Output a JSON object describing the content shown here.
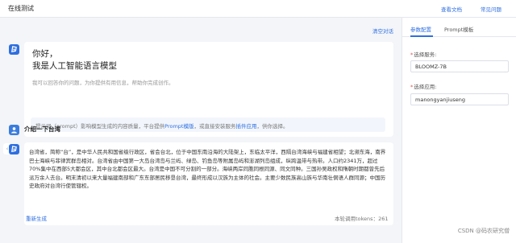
{
  "topbar": {
    "title": "在线测试",
    "docs_link": "查看文档",
    "faq_link": "常见问题"
  },
  "chat": {
    "clear_label": "清空对话",
    "welcome": {
      "greet_line1": "你好，",
      "greet_line2": "我是人工智能语言模型",
      "subtitle": "我可以回答你的问题，为你提供有用信息，帮助你完成创作。",
      "tip_prefix": "提示词（prompt）影响模型生成的内容质量，平台提供",
      "tip_link1": "Prompt模版",
      "tip_middle": "，或直接安装服务",
      "tip_link2": "插件应用",
      "tip_suffix": "，供你选择。"
    },
    "user_message": "介绍一下台湾",
    "reply_text": "台湾省，简称“台”，是中华人民共和国省级行政区，省会台北，位于中国东南沿海的大陆架上，东临太平洋，西隔台湾海峡与福建省相望；北濒东海，南界巴士海峡与菲律宾群岛相对。台湾省由中国第一大岛台湾岛与兰屿、绿岛、钓鱼岛等附属岛屿和澎湖列岛组成，纵跨温带与热带。人口约2341万，超过70%集中在西部5大都会区，其中台北都会区最大。台湾是中国不可分割的一部分。海峡两岸同胞同根同源、同文同种。三国孙吴政权和隋朝时期都曾先后派万余人去台。明末清初以来大量福建南部和广东东部居民移垦台湾，最终形成以汉族为主体的社会。主要少数民族高山族与华南壮侗语人群同源；中国历史政府对台湾行使管辖权。",
    "regenerate_label": "重新生成",
    "tokens_label": "本轮调用tokens：261",
    "scroll_glyph": "‹"
  },
  "panel": {
    "tabs": [
      {
        "label": "参数配置",
        "active": true
      },
      {
        "label": "Prompt模板",
        "active": false
      }
    ],
    "service_label": "选择服务:",
    "service_value": "BLOOMZ-7B",
    "app_label": "选择应用:",
    "app_value": "manongyanjiuseng",
    "required_mark": "*"
  },
  "watermark": "CSDN @码农研究僧",
  "colors": {
    "accent": "#2f6fe0",
    "background": "#eef1f6",
    "card": "#ffffff"
  },
  "icons": {
    "bot_avatar": "ernie-logo-icon",
    "user_avatar": "user-icon"
  }
}
